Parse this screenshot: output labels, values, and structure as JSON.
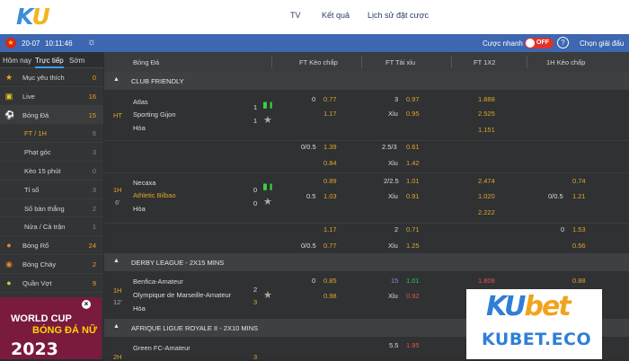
{
  "topbar": {
    "logo_k": "K",
    "logo_u": "U",
    "nav": [
      "TV",
      "Kết quả",
      "Lịch sử đặt cược"
    ]
  },
  "statusbar": {
    "date": "20-07",
    "time": "10:11:46",
    "fast_bet": "Cược nhanh",
    "toggle": "OFF",
    "help": "?",
    "choose": "Chọn giải đấu"
  },
  "sidebar": {
    "tabs": [
      "Hôm nay",
      "Trực tiếp",
      "Sớm"
    ],
    "items": [
      {
        "label": "Mục yêu thích",
        "count": "0",
        "icon": "star-icon"
      },
      {
        "label": "Live",
        "count": "16",
        "icon": "tv-icon"
      },
      {
        "label": "Bóng Đá",
        "count": "15",
        "icon": "soccer-icon"
      },
      {
        "label": "FT / 1H",
        "count": "6"
      },
      {
        "label": "Phạt góc",
        "count": "3"
      },
      {
        "label": "Kèo 15 phút",
        "count": "0"
      },
      {
        "label": "Tỉ số",
        "count": "3"
      },
      {
        "label": "Số bàn thắng",
        "count": "2"
      },
      {
        "label": "Nửa / Cả trận",
        "count": "1"
      },
      {
        "label": "Bóng Rổ",
        "count": "24",
        "icon": "basketball-icon"
      },
      {
        "label": "Bóng Chày",
        "count": "2",
        "icon": "baseball-icon"
      },
      {
        "label": "Quần Vợt",
        "count": "9",
        "icon": "tennis-icon"
      }
    ]
  },
  "banner": {
    "close": "×",
    "line1": "WORLD CUP",
    "line2": "BÓNG ĐÁ NỮ",
    "line3": "2023"
  },
  "table": {
    "headers": [
      "Bóng Đá",
      "FT Kèo chấp",
      "FT Tài xỉu",
      "FT 1X2",
      "1H Kèo chấp"
    ]
  },
  "leagues": [
    "CLUB FRIENDLY",
    "DERBY LEAGUE - 2X15 MINS",
    "AFRIQUE LIGUE ROYALE II - 2X10 MINS"
  ],
  "m1": {
    "period": "HT",
    "home": "Atlas",
    "away": "Sporting Gijon",
    "draw": "Hòa",
    "hs": "1",
    "as": "1",
    "r1": [
      "0",
      "0.77",
      "3",
      "0.97",
      "1.888"
    ],
    "r2": [
      "1.17",
      "Xỉu",
      "0.95",
      "2.525"
    ],
    "r3": "1.151",
    "e1": [
      "0/0.5",
      "1.39",
      "2.5/3",
      "0.61"
    ],
    "e2": [
      "0.84",
      "Xỉu",
      "1.42"
    ]
  },
  "m2": {
    "period": "1H",
    "minute": "6'",
    "home": "Necaxa",
    "away": "Athletic Bilbao",
    "draw": "Hòa",
    "hs": "0",
    "as": "0",
    "r1": [
      "0.89",
      "2/2.5",
      "1.01",
      "2.474",
      "0.74"
    ],
    "r2": [
      "0.5",
      "1.03",
      "Xỉu",
      "0.91",
      "1.020",
      "0/0.5",
      "1.21"
    ],
    "r3": "2.222",
    "e1": [
      "1.17",
      "2",
      "0.71",
      "0",
      "1.53"
    ],
    "e2": [
      "0/0.5",
      "0.77",
      "Xỉu",
      "1.25",
      "0.56"
    ]
  },
  "m3": {
    "period": "1H",
    "minute": "12'",
    "home": "Benfica-Amateur",
    "away": "Olympique de Marseille-Amateur",
    "draw": "Hòa",
    "hs": "2",
    "as": "3",
    "r1": [
      "0",
      "0.85",
      "15",
      "1.01",
      "1.808",
      "0.88"
    ],
    "r2": [
      "0.98",
      "Xỉu",
      "0.92"
    ]
  },
  "m4": {
    "period": "2H",
    "home": "Green FC-Amateur",
    "r1": [
      "5.5",
      "1.95"
    ],
    "hs": "3"
  },
  "ad": {
    "ku": "KU",
    "bet": "bet",
    "site": "KUBET.ECO"
  }
}
